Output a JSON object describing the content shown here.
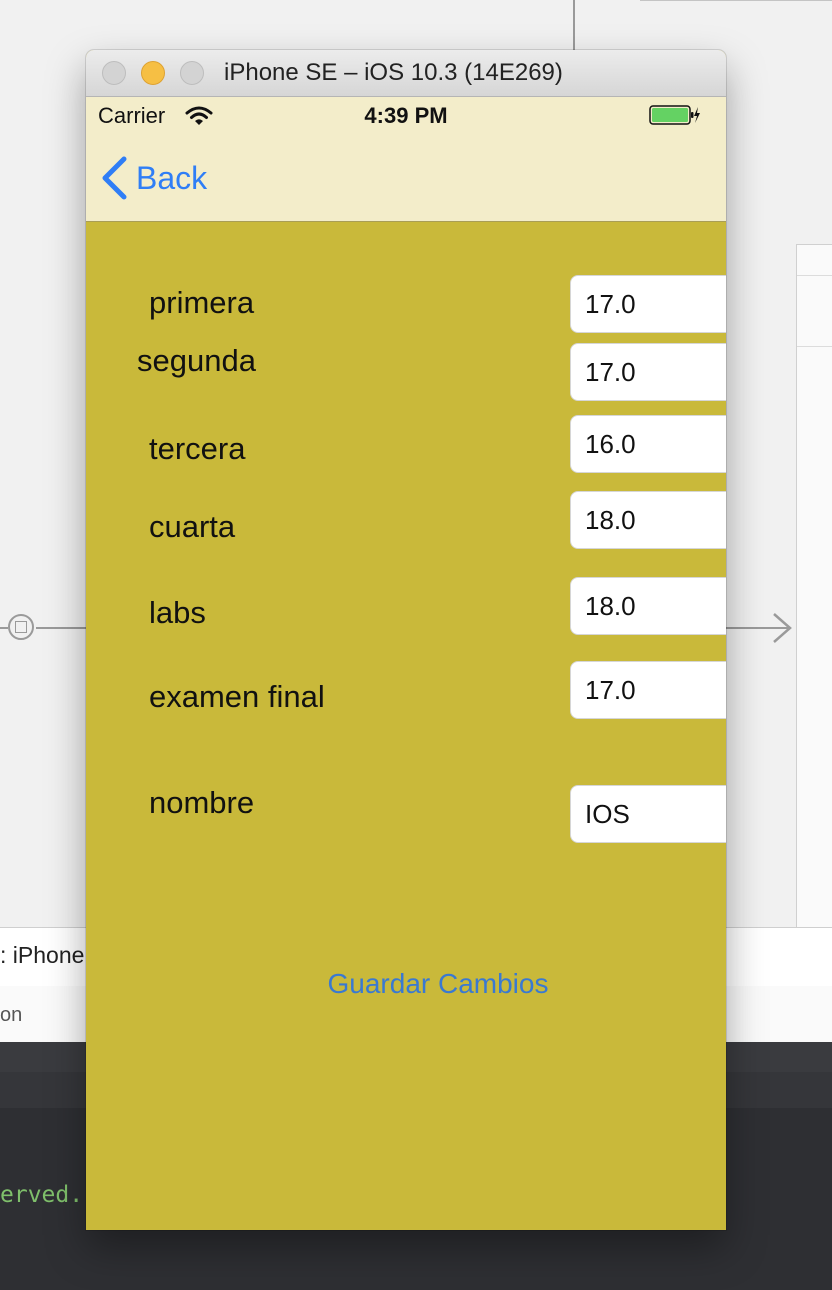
{
  "background": {
    "device_bar_text": ": iPhone",
    "panel_bar_text": "on",
    "console_text": "erved."
  },
  "simulator": {
    "title": "iPhone SE – iOS 10.3 (14E269)",
    "status_bar": {
      "carrier": "Carrier",
      "time": "4:39 PM",
      "battery_color": "#64d263"
    },
    "nav": {
      "back_label": "Back",
      "tint_color": "#2f7ef6"
    },
    "form": {
      "fields": [
        {
          "label": "primera",
          "value": "17.0"
        },
        {
          "label": "segunda",
          "value": "17.0"
        },
        {
          "label": "tercera",
          "value": "16.0"
        },
        {
          "label": "cuarta",
          "value": "18.0"
        },
        {
          "label": "labs",
          "value": "18.0"
        },
        {
          "label": "examen final",
          "value": "17.0"
        },
        {
          "label": "nombre",
          "value": "IOS"
        }
      ],
      "save_label": "Guardar Cambios",
      "background_color": "#c9b93a"
    }
  }
}
